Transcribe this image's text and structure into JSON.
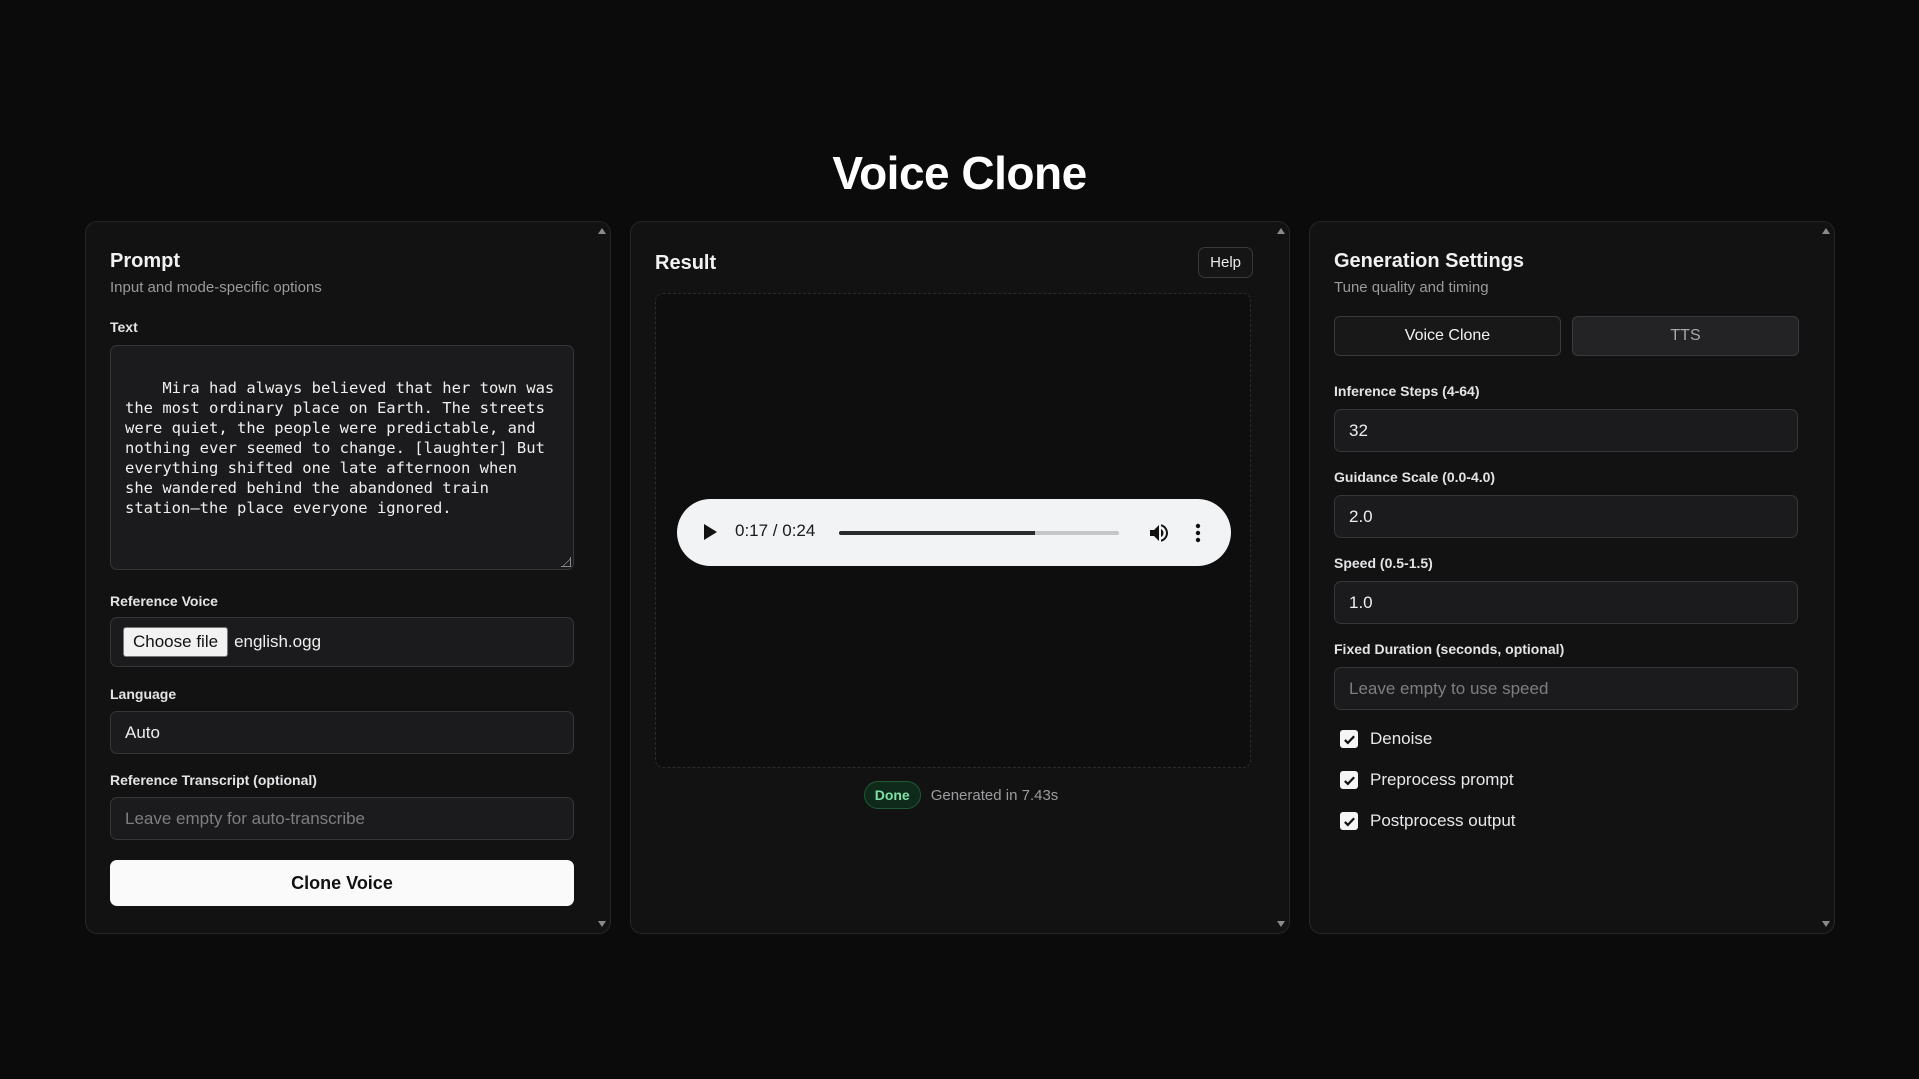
{
  "page": {
    "title": "Voice Clone"
  },
  "prompt": {
    "heading": "Prompt",
    "subtitle": "Input and mode-specific options",
    "text_label": "Text",
    "text_value": "Mira had always believed that her town was\nthe most ordinary place on Earth. The streets\nwere quiet, the people were predictable, and\nnothing ever seemed to change. [laughter] But\neverything shifted one late afternoon when\nshe wandered behind the abandoned train\nstation—the place everyone ignored.",
    "ref_voice_label": "Reference Voice",
    "choose_file_label": "Choose file",
    "file_name": "english.ogg",
    "language_label": "Language",
    "language_value": "Auto",
    "transcript_label": "Reference Transcript (optional)",
    "transcript_placeholder": "Leave empty for auto-transcribe",
    "clone_button": "Clone Voice"
  },
  "result": {
    "heading": "Result",
    "help_button": "Help",
    "audio": {
      "time": "0:17 / 0:24",
      "progress": 0.7
    },
    "status_badge": "Done",
    "status_text": "Generated in 7.43s"
  },
  "settings": {
    "heading": "Generation Settings",
    "subtitle": "Tune quality and timing",
    "modes": [
      "Voice Clone",
      "TTS"
    ],
    "active_mode": "Voice Clone",
    "steps_label": "Inference Steps (4-64)",
    "steps_value": "32",
    "guidance_label": "Guidance Scale (0.0-4.0)",
    "guidance_value": "2.0",
    "speed_label": "Speed (0.5-1.5)",
    "speed_value": "1.0",
    "duration_label": "Fixed Duration (seconds, optional)",
    "duration_placeholder": "Leave empty to use speed",
    "checks": [
      {
        "label": "Denoise",
        "checked": true
      },
      {
        "label": "Preprocess prompt",
        "checked": true
      },
      {
        "label": "Postprocess output",
        "checked": true
      }
    ]
  },
  "colors": {
    "background": "#0b0b0c",
    "panel": "#121213",
    "accent_success": "#7fe0a4"
  }
}
